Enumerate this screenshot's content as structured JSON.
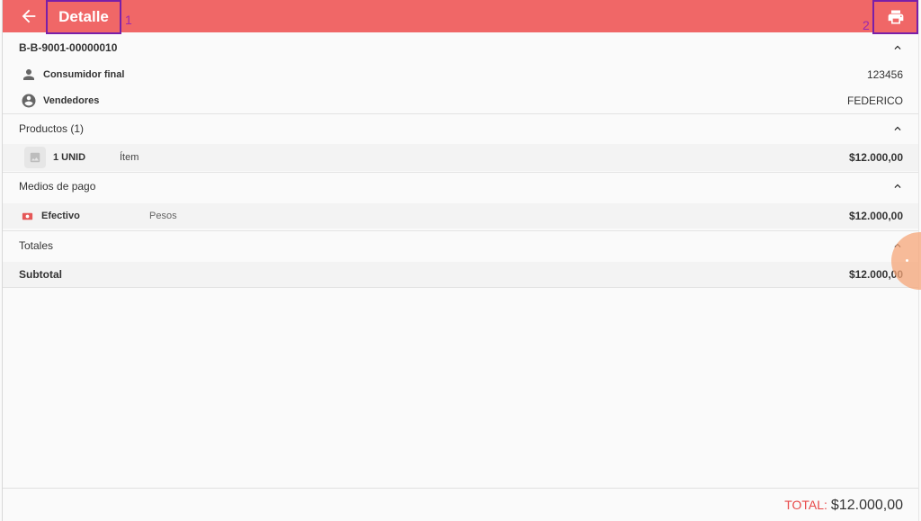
{
  "appbar": {
    "title": "Detalle",
    "back_icon": "arrow-back-icon",
    "print_icon": "printer-icon",
    "color": "#f06767"
  },
  "marks": {
    "one": "1",
    "two": "2"
  },
  "invoice": {
    "number": "B-B-9001-00000010",
    "customer_label": "Consumidor final",
    "customer_value": "123456",
    "seller_label": "Vendedores",
    "seller_value": "FEDERICO"
  },
  "products": {
    "header": "Productos (1)",
    "items": [
      {
        "qty": "1 UNID",
        "name": "Ítem",
        "price": "$12.000,00"
      }
    ]
  },
  "payments": {
    "header": "Medios de pago",
    "items": [
      {
        "method": "Efectivo",
        "currency": "Pesos",
        "amount": "$12.000,00"
      }
    ]
  },
  "totals": {
    "header": "Totales",
    "subtotal_label": "Subtotal",
    "subtotal_value": "$12.000,00"
  },
  "footer": {
    "total_label": "TOTAL:",
    "total_value": "$12.000,00",
    "total_label_color": "#e84848"
  }
}
